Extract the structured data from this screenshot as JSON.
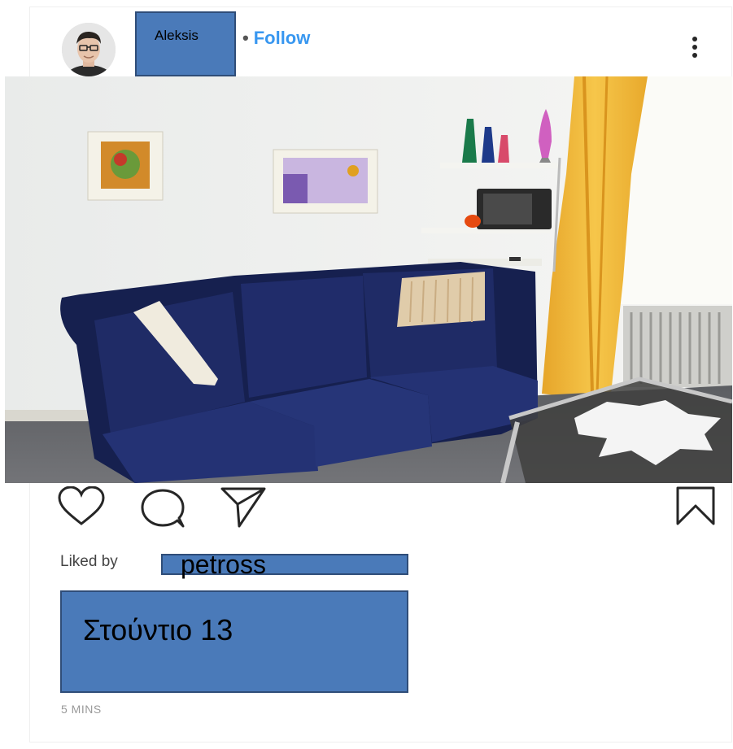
{
  "post": {
    "username": "Aleksis",
    "separator": "•",
    "follow_label": "Follow",
    "liked_by_prefix": "Liked by",
    "liked_by_user": "petross",
    "caption": "Στούντιο 13",
    "timestamp": "5 MINS"
  },
  "icons": {
    "like": "heart-icon",
    "comment": "comment-icon",
    "share": "send-icon",
    "save": "bookmark-icon",
    "more": "more-options-icon"
  },
  "colors": {
    "follow": "#3897f0",
    "redaction_box": "#4a7ab9",
    "sofa": "#1e2a66",
    "curtain": "#f0b83a"
  }
}
